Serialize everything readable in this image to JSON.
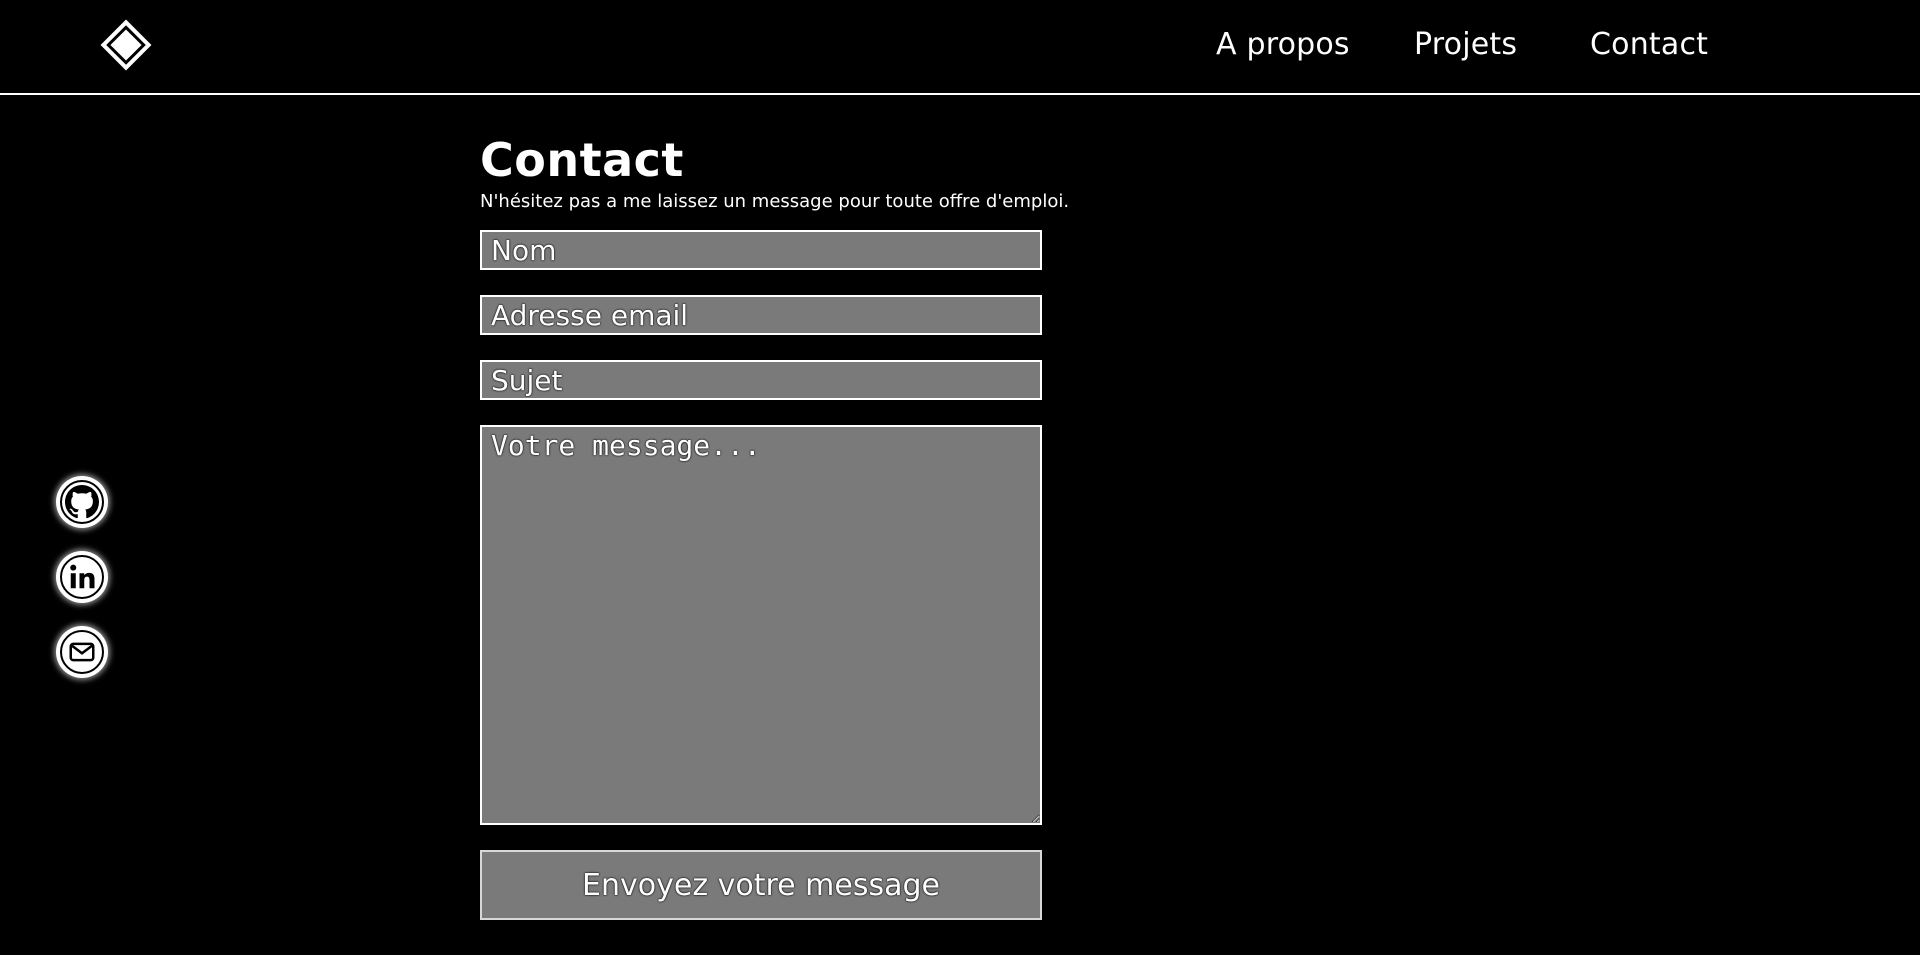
{
  "header": {
    "logo_icon": "diamond-logo-icon",
    "nav": {
      "about": "A propos",
      "projects": "Projets",
      "contact": "Contact"
    }
  },
  "social": {
    "items": [
      {
        "icon": "github-icon"
      },
      {
        "icon": "linkedin-icon"
      },
      {
        "icon": "mail-icon"
      }
    ]
  },
  "contact": {
    "title": "Contact",
    "subtitle": "N'hésitez pas a me laissez un message pour toute offre d'emploi.",
    "fields": {
      "name_placeholder": "Nom",
      "email_placeholder": "Adresse email",
      "subject_placeholder": "Sujet",
      "message_placeholder": "Votre message..."
    },
    "submit_label": "Envoyez votre message"
  },
  "colors": {
    "background": "#000000",
    "foreground": "#ffffff",
    "field_background": "#7a7a7a"
  }
}
